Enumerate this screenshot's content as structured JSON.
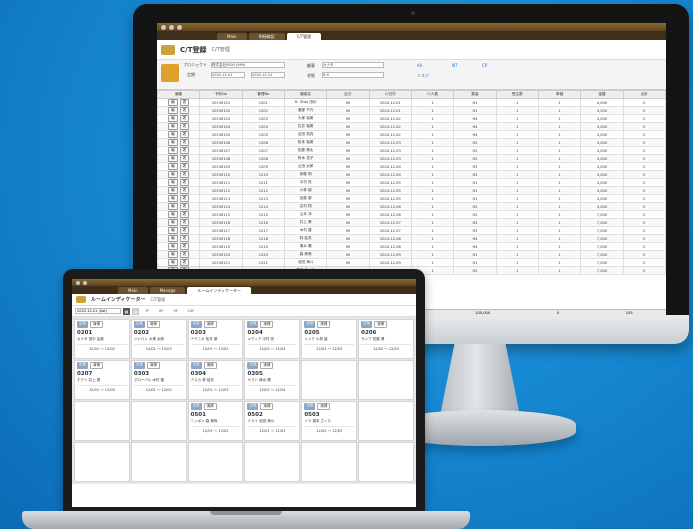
{
  "monitor": {
    "tabs": [
      "Main",
      "明細確認",
      "C/T管理"
    ],
    "active_tab": 2,
    "title": "C/T登録",
    "subtitle": "C/T管理",
    "section_label": "検索条件",
    "filter": {
      "product_label": "プロジェクト",
      "product_value": "株式会社0000 (999)",
      "date_label": "定期",
      "date_from": "2020-12-01",
      "date_to": "2020-12-31",
      "customer_label": "顧客",
      "customer_value": "カナタ",
      "status_label": "状態",
      "status_value": "9-9",
      "opt1": "All",
      "opt2": "NT",
      "opt3": "CP",
      "opt4": "リスク"
    },
    "columns": [
      "編集",
      "C/T",
      "予約No",
      "GP ID",
      "管理No",
      "顧客名",
      "区分",
      "C/日付",
      "C/時間",
      "C/状態",
      "C/人数",
      "日数",
      "数量",
      "RoCコード",
      "",
      "受注数",
      "出荷数",
      "単価",
      "金額",
      "RoC",
      "合計"
    ],
    "rows": [
      [
        "20190101",
        "1201",
        "H. Ohta 田中",
        "Mi",
        "2020-12-01",
        "1",
        "H1",
        "1",
        "1",
        "4,000",
        "0",
        "4"
      ],
      [
        "20190102",
        "1202",
        "渡部 千代",
        "Mi",
        "2020-12-01",
        "1",
        "H1",
        "1",
        "1",
        "4,200",
        "0",
        "4"
      ],
      [
        "20190103",
        "1203",
        "大塚 裕美",
        "Mi",
        "2020-12-02",
        "1",
        "H4",
        "1",
        "1",
        "4,000",
        "0",
        "4"
      ],
      [
        "20190104",
        "1204",
        "石井 裕美",
        "Mi",
        "2020-12-02",
        "1",
        "H4",
        "1",
        "1",
        "4,000",
        "0",
        "4"
      ],
      [
        "20190105",
        "1205",
        "吉田 拓真",
        "Mi",
        "2020-12-02",
        "1",
        "H4",
        "1",
        "1",
        "4,000",
        "0",
        "4"
      ],
      [
        "20190106",
        "1206",
        "松本 裕美",
        "Mi",
        "2020-12-03",
        "1",
        "H2",
        "1",
        "1",
        "4,000",
        "0",
        "4"
      ],
      [
        "20190107",
        "1207",
        "佐藤 健太",
        "Mi",
        "2020-12-03",
        "1",
        "H2",
        "1",
        "1",
        "4,000",
        "0",
        "4"
      ],
      [
        "20190108",
        "1208",
        "鈴木 花子",
        "Mi",
        "2020-12-03",
        "1",
        "H2",
        "1",
        "1",
        "4,000",
        "0",
        "4"
      ],
      [
        "20190109",
        "1209",
        "山田 太郎",
        "Mi",
        "2020-12-04",
        "1",
        "H3",
        "1",
        "1",
        "4,000",
        "0",
        "4"
      ],
      [
        "20190110",
        "1210",
        "伊藤 明",
        "Mi",
        "2020-12-04",
        "1",
        "H3",
        "1",
        "1",
        "4,000",
        "0",
        "4"
      ],
      [
        "20190111",
        "1211",
        "中村 亮",
        "Mi",
        "2020-12-05",
        "1",
        "H1",
        "1",
        "1",
        "4,000",
        "0",
        "4"
      ],
      [
        "20190112",
        "1212",
        "小林 誠",
        "Mi",
        "2020-12-05",
        "1",
        "H1",
        "1",
        "1",
        "4,000",
        "0",
        "4"
      ],
      [
        "20190113",
        "1213",
        "加藤 優",
        "Mi",
        "2020-12-05",
        "1",
        "H1",
        "1",
        "1",
        "4,000",
        "0",
        "4"
      ],
      [
        "20190114",
        "1214",
        "吉村 翔",
        "Mi",
        "2020-12-06",
        "1",
        "H2",
        "1",
        "1",
        "4,000",
        "0",
        "4"
      ],
      [
        "20190115",
        "1215",
        "山本 涼",
        "Mi",
        "2020-12-06",
        "1",
        "H2",
        "1",
        "1",
        "7,000",
        "0",
        "7"
      ],
      [
        "20190116",
        "1216",
        "井上 葵",
        "Mi",
        "2020-12-07",
        "1",
        "H3",
        "1",
        "1",
        "7,000",
        "0",
        "7"
      ],
      [
        "20190117",
        "1217",
        "木村 蓮",
        "Mi",
        "2020-12-07",
        "1",
        "H3",
        "1",
        "1",
        "7,000",
        "0",
        "7"
      ],
      [
        "20190118",
        "1218",
        "林 結衣",
        "Mi",
        "2020-12-08",
        "1",
        "H4",
        "1",
        "1",
        "7,000",
        "0",
        "7"
      ],
      [
        "20190119",
        "1219",
        "清水 陽",
        "Mi",
        "2020-12-08",
        "1",
        "H4",
        "1",
        "1",
        "7,000",
        "0",
        "7"
      ],
      [
        "20190120",
        "1220",
        "森 美咲",
        "Mi",
        "2020-12-09",
        "1",
        "H1",
        "1",
        "1",
        "7,000",
        "0",
        "7"
      ],
      [
        "20190121",
        "1221",
        "池田 海斗",
        "Mi",
        "2020-12-09",
        "1",
        "H1",
        "1",
        "1",
        "7,000",
        "0",
        "7"
      ],
      [
        "20190122",
        "1222",
        "橋本 さくら",
        "Mi",
        "2020-12-10",
        "1",
        "H2",
        "1",
        "1",
        "7,000",
        "0",
        "7"
      ]
    ],
    "edit_btn": "編",
    "view_btn": "表",
    "footer": [
      "18",
      "18",
      "18",
      "18",
      "105,000",
      "0",
      "105"
    ]
  },
  "laptop": {
    "tabs": [
      "Main",
      "Manage",
      "ルームインディケーター"
    ],
    "active_tab": 2,
    "title": "ルームインディケーター",
    "subtitle": "C/T管理",
    "search_value": "2020-12-01 (Sat)",
    "filter_tabs": [
      "7F",
      "8F",
      "9F",
      "10F"
    ],
    "rooms": [
      {
        "code": "0201",
        "name": "カナタ 田中 由美",
        "detail": "12/01 ～ 12/02"
      },
      {
        "code": "0202",
        "name": "ジャパン 大塚 太郎",
        "detail": "12/01 ～ 12/03"
      },
      {
        "code": "0203",
        "name": "テクニカ 松本 優",
        "detail": "12/01 ～ 12/02"
      },
      {
        "code": "0204",
        "name": "メディア 中村 亮",
        "detail": "12/02 ～ 12/04"
      },
      {
        "code": "0205",
        "name": "リンク 小林 誠",
        "detail": "12/01 ～ 12/03"
      },
      {
        "code": "0206",
        "name": "サンワ 佐藤 健",
        "detail": "12/02 ～ 12/03"
      },
      {
        "code": "0207",
        "name": "ホクト 井上 葵",
        "detail": "12/01 ～ 12/05"
      },
      {
        "code": "0303",
        "name": "グローバル 木村 蓮",
        "detail": "12/01 ～ 12/02"
      },
      {
        "code": "0304",
        "name": "アスカ 林 結衣",
        "detail": "12/01 ～ 12/03"
      },
      {
        "code": "0305",
        "name": "ヤマト 清水 陽",
        "detail": "12/02 ～ 12/04"
      },
      {
        "code": "0501",
        "name": "ニッポン 森 美咲",
        "detail": "12/01 ～ 12/02"
      },
      {
        "code": "0502",
        "name": "ミライ 池田 海斗",
        "detail": "12/01 ～ 12/03"
      },
      {
        "code": "0503",
        "name": "ソラ 橋本 さくら",
        "detail": "12/02 ～ 12/03"
      }
    ],
    "tag_a": "空室",
    "tag_b": "清掃"
  }
}
